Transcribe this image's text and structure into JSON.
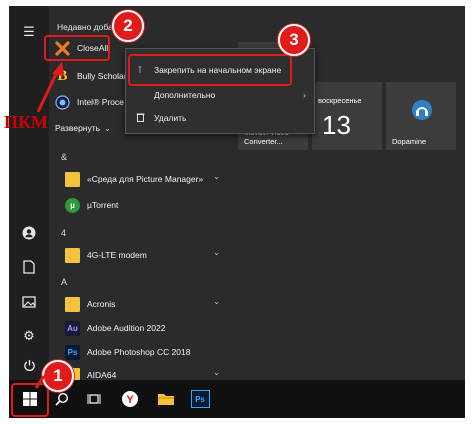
{
  "start_menu": {
    "recent_header": "Недавно добав",
    "expand_label": "Развернуть",
    "recent_apps": [
      {
        "label": "CloseAll",
        "icon": "closeall-x-icon"
      },
      {
        "label": "Bully Scholar",
        "icon": "bully-icon"
      },
      {
        "label": "Intel® Proce",
        "icon": "intel-icon"
      }
    ],
    "groups": [
      {
        "letter": "&",
        "apps": [
          {
            "label": "«Среда для Picture Manager»",
            "icon": "folder-icon",
            "chevron": true
          },
          {
            "label": "µTorrent",
            "icon": "utorrent-icon"
          }
        ]
      },
      {
        "letter": "4",
        "apps": [
          {
            "label": "4G-LTE modem",
            "icon": "folder-icon",
            "chevron": true
          }
        ]
      },
      {
        "letter": "A",
        "apps": [
          {
            "label": "Acronis",
            "icon": "folder-icon",
            "chevron": true
          },
          {
            "label": "Adobe Audition 2022",
            "icon": "audition-icon"
          },
          {
            "label": "Adobe Photoshop CC 2018",
            "icon": "photoshop-icon"
          },
          {
            "label": "AIDA64",
            "icon": "folder-icon",
            "chevron": true
          }
        ]
      }
    ]
  },
  "context_menu": {
    "pin_label": "Закрепить на начальном экране",
    "more_label": "Дополнительно",
    "delete_label": "Удалить"
  },
  "tiles": {
    "movavi_label": "Movavi Video Converter...",
    "calendar_day": "воскресенье",
    "calendar_date": "13",
    "dopamine_label": "Dopamine"
  },
  "annotations": {
    "pkm_label": "ПКМ",
    "step1": "1",
    "step2": "2",
    "step3": "3",
    "accent_color": "#e11a1a"
  },
  "taskbar": {
    "photoshop_label": "Ps"
  }
}
